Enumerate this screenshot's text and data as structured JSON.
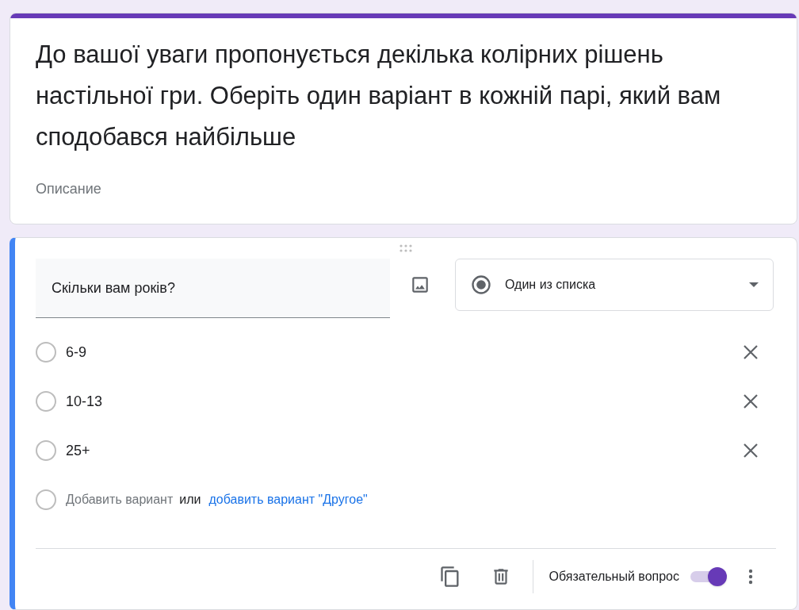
{
  "header": {
    "title": "До вашої уваги пропонується декілька колірних рішень настільної гри. Оберіть один варіант в кожній парі, який вам сподобався найбільше",
    "description_placeholder": "Описание"
  },
  "question": {
    "title": "Скільки вам років?",
    "type": "Один из списка",
    "options": [
      {
        "label": "6-9"
      },
      {
        "label": "10-13"
      },
      {
        "label": "25+"
      }
    ],
    "add_option": {
      "placeholder": "Добавить вариант",
      "separator": "или",
      "other_link": "добавить вариант \"Другое\""
    },
    "required": {
      "label": "Обязательный вопрос",
      "on": true
    }
  }
}
